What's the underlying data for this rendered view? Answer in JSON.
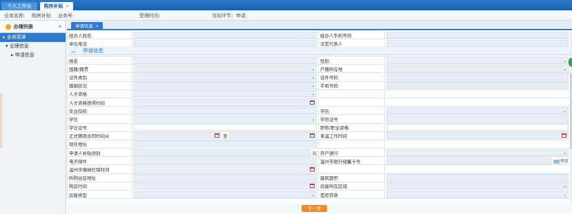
{
  "top_tabs": [
    {
      "label": "个人工作台"
    },
    {
      "label": "购房补贴",
      "close": "×"
    }
  ],
  "infobar": {
    "biz_name_label": "业务名称:",
    "biz_name_value": "购房补贴",
    "biz_no_label": "业务号:",
    "accept_time_label": "受理时间:",
    "current_step_label": "当前环节:",
    "current_step_value": "申请"
  },
  "sidebar": {
    "title": "办理列表",
    "collapse": "«",
    "items": [
      {
        "label": "▸ 业务菜单"
      },
      {
        "label": "▾ 业理信息"
      },
      {
        "label": "▸ 申请信息"
      }
    ]
  },
  "content_tab": {
    "label": "申请信息",
    "close": "×"
  },
  "top_rows": [
    {
      "left_label": "经办人姓名",
      "right_label": "经办人手机号码"
    },
    {
      "left_label": "单位电话",
      "right_label": "法定代表人"
    }
  ],
  "section": {
    "chevron": "︽",
    "title": "申请信息"
  },
  "rows": [
    {
      "l": "姓名",
      "lt": "text",
      "r": "性别",
      "rt": "select"
    },
    {
      "l": "国籍/籍贯",
      "lt": "select",
      "r": "户籍所在地",
      "rt": "select"
    },
    {
      "l": "证件类别",
      "lt": "select",
      "r": "证件号码",
      "rt": "text"
    },
    {
      "l": "婚姻状况",
      "lt": "select",
      "r": "手机号码",
      "rt": "text"
    },
    {
      "l": "人才资格",
      "lt": "select",
      "r": "",
      "rt": "none"
    },
    {
      "l": "人才资格获得时间",
      "lt": "date",
      "r": "",
      "rt": "none"
    },
    {
      "l": "毕业院校",
      "lt": "text",
      "r": "学历",
      "rt": "select"
    },
    {
      "l": "学位",
      "lt": "select",
      "r": "学历证号",
      "rt": "text"
    },
    {
      "l": "学位证号",
      "lt": "white",
      "r": "职称/职业资格",
      "rt": "white"
    },
    {
      "l": "正式聘用合同时间从",
      "lt": "range",
      "r": "来温工作时间",
      "rt": "date"
    },
    {
      "l": "现任地址",
      "lt": "text",
      "r": "",
      "rt": "none"
    },
    {
      "l": "申请人补贴测别",
      "lt": "suffix",
      "r": "开户银行",
      "rt": "select"
    },
    {
      "l": "电子邮件",
      "lt": "text",
      "r": "温州市银行储蓄卡号",
      "rt": "preview"
    },
    {
      "l": "温州市缴纳社保时间",
      "lt": "date",
      "r": "",
      "rt": "none"
    },
    {
      "l": "所购住房地址",
      "lt": "text",
      "r": "建筑面积",
      "rt": "text"
    },
    {
      "l": "购房时间",
      "lt": "date",
      "r": "房屋所在区域",
      "rt": "select"
    },
    {
      "l": "房屋类型",
      "lt": "select",
      "r": "是否贷款",
      "rt": "select"
    }
  ],
  "range_sep": "至",
  "unit_yuan": "元",
  "preview_label": "预览",
  "next_button": "下一步"
}
